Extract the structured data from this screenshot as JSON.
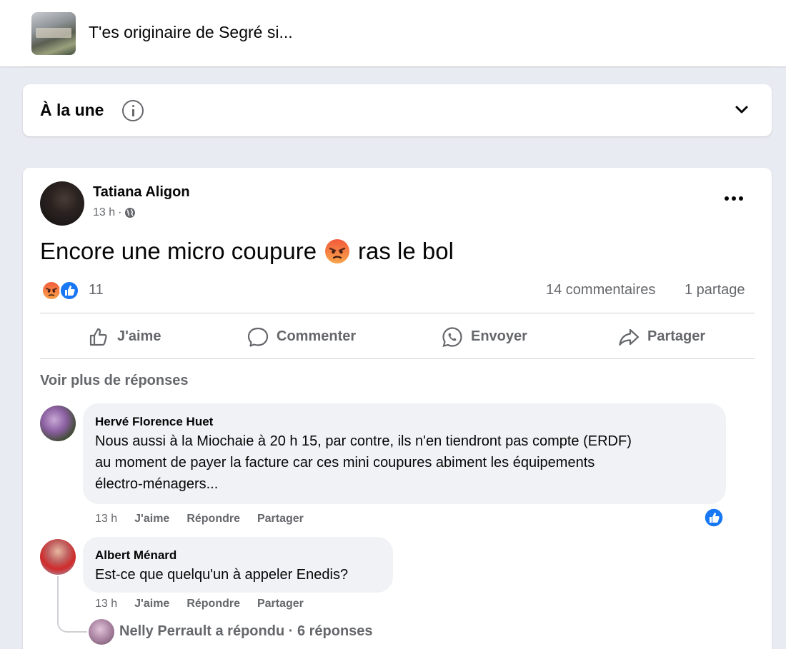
{
  "group": {
    "title": "T'es originaire de Segré si..."
  },
  "sort": {
    "label": "À la une",
    "info_icon": "info-icon",
    "chevron_icon": "chevron-down-icon"
  },
  "post": {
    "author": "Tatiana Aligon",
    "time": "13 h",
    "audience_icon": "globe-icon",
    "text_before": "Encore une micro coupure",
    "emoji": "angry-face",
    "text_after": "ras le bol",
    "reaction_count": "11",
    "comments_count": "14 commentaires",
    "shares_count": "1 partage",
    "actions": {
      "like": "J'aime",
      "comment": "Commenter",
      "send": "Envoyer",
      "share": "Partager"
    },
    "more_replies": "Voir plus de réponses"
  },
  "comments": [
    {
      "author": "Hervé Florence Huet",
      "lines": [
        "Nous aussi à la Miochaie à 20 h 15, par contre, ils n'en tiendront pas compte (ERDF)",
        "au moment de payer la facture car ces mini coupures abiment les équipements",
        "électro-ménagers..."
      ],
      "time": "13 h",
      "like": "J'aime",
      "reply": "Répondre",
      "share": "Partager",
      "reaction": "like"
    },
    {
      "author": "Albert Ménard",
      "lines": [
        "Est-ce que quelqu'un à appeler Enedis?"
      ],
      "time": "13 h",
      "like": "J'aime",
      "reply": "Répondre",
      "share": "Partager",
      "replies_summary": "Nelly Perrault a répondu · 6 réponses"
    }
  ],
  "colors": {
    "facebook_blue": "#1877f2",
    "secondary_text": "#65676b",
    "page_bg": "#e9ebf2",
    "bubble_bg": "#f0f2f5",
    "angry": "#f7714c"
  }
}
